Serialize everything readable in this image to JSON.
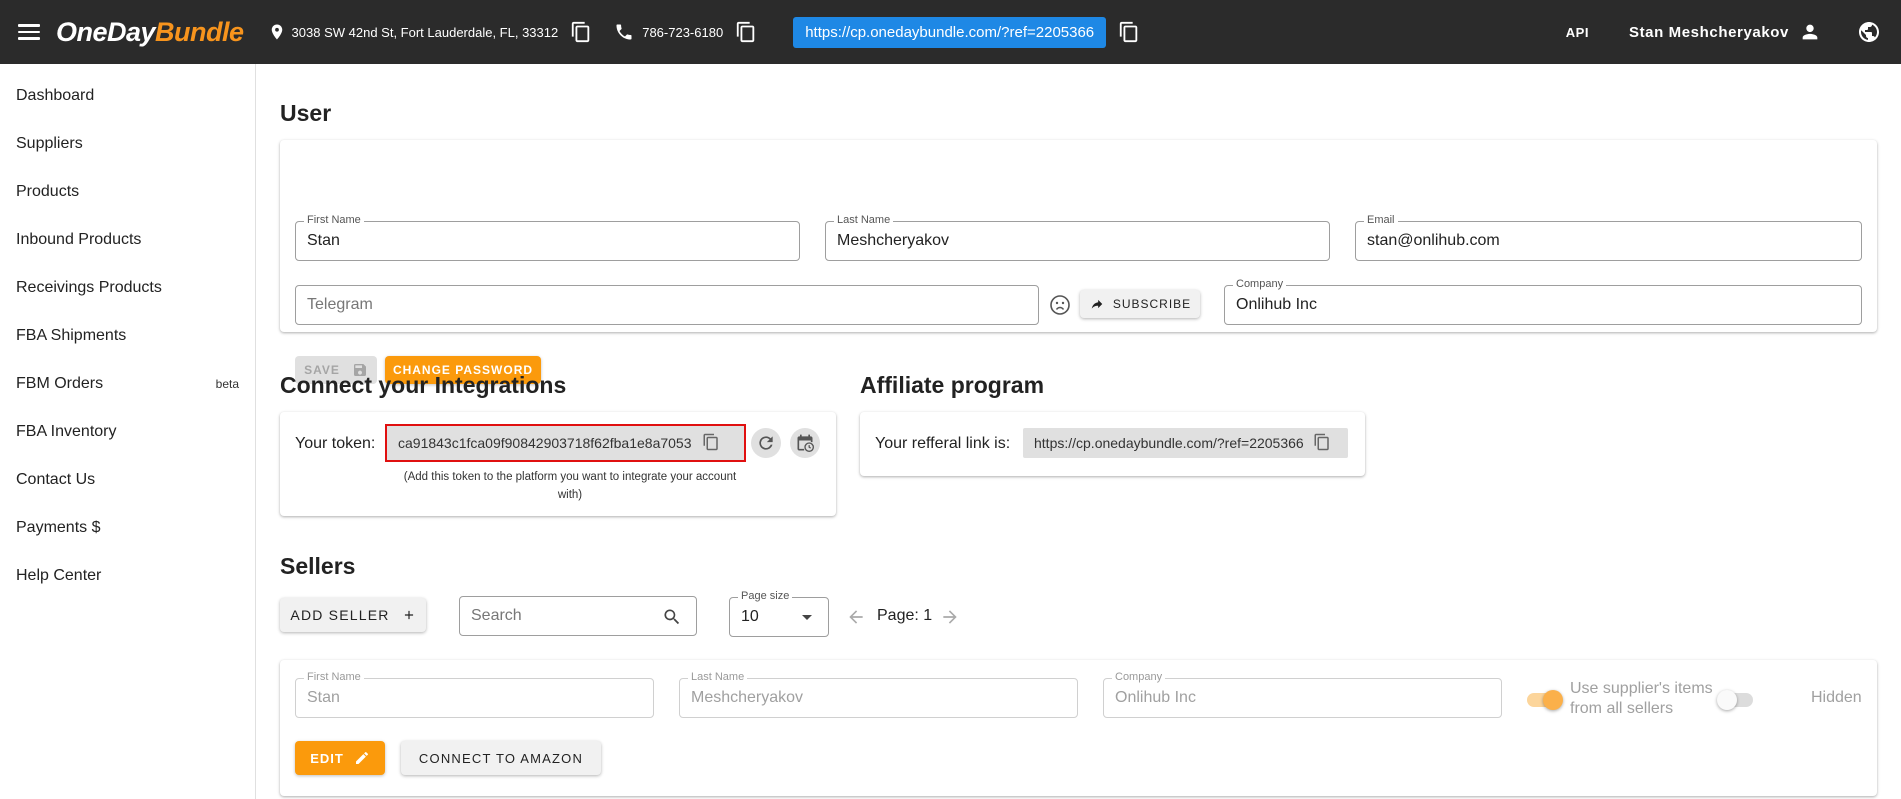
{
  "topbar": {
    "logo_part1": "OneDay",
    "logo_part2": "Bundle",
    "address": "3038 SW 42nd St, Fort Lauderdale, FL, 33312",
    "phone": "786-723-6180",
    "referral_url": "https://cp.onedaybundle.com/?ref=2205366",
    "api_label": "API",
    "user_name": "Stan Meshcheryakov"
  },
  "sidebar": {
    "items": [
      {
        "label": "Dashboard"
      },
      {
        "label": "Suppliers"
      },
      {
        "label": "Products"
      },
      {
        "label": "Inbound Products"
      },
      {
        "label": "Receivings Products"
      },
      {
        "label": "FBA Shipments"
      },
      {
        "label": "FBM Orders",
        "badge": "beta"
      },
      {
        "label": "FBA Inventory"
      },
      {
        "label": "Contact Us"
      },
      {
        "label": "Payments $"
      },
      {
        "label": "Help Center"
      }
    ]
  },
  "user": {
    "title": "User",
    "first_name_label": "First Name",
    "first_name": "Stan",
    "last_name_label": "Last Name",
    "last_name": "Meshcheryakov",
    "email_label": "Email",
    "email": "stan@onlihub.com",
    "telegram_placeholder": "Telegram",
    "subscribe_label": "SUBSCRIBE",
    "company_label": "Company",
    "company": "Onlihub Inc",
    "save_label": "SAVE",
    "change_password_label": "CHANGE PASSWORD"
  },
  "integrations": {
    "title": "Connect your Integrations",
    "token_label": "Your token:",
    "token": "ca91843c1fca09f90842903718f62fba1e8a7053",
    "hint_line1": "(Add this token to the platform you want to integrate your account",
    "hint_line2": "with)"
  },
  "affiliate": {
    "title": "Affiliate program",
    "link_label": "Your refferal link is:",
    "link": "https://cp.onedaybundle.com/?ref=2205366"
  },
  "sellers": {
    "title": "Sellers",
    "add_seller_label": "ADD SELLER",
    "search_placeholder": "Search",
    "page_size_label": "Page size",
    "page_size": "10",
    "page_text": "Page: 1",
    "row": {
      "first_name_label": "First Name",
      "first_name": "Stan",
      "last_name_label": "Last Name",
      "last_name": "Meshcheryakov",
      "company_label": "Company",
      "company": "Onlihub Inc",
      "use_supplier_line1": "Use supplier's items",
      "use_supplier_line2": "from all sellers",
      "use_supplier_on": true,
      "hidden_label": "Hidden",
      "hidden_on": false,
      "edit_label": "EDIT",
      "connect_label": "CONNECT TO AMAZON"
    }
  },
  "colors": {
    "topbar": "#2b2b2b",
    "brand_orange": "#f7941d",
    "button_orange": "#fb9a0c",
    "link_blue": "#1e88e5",
    "highlight_red": "#e01010"
  }
}
